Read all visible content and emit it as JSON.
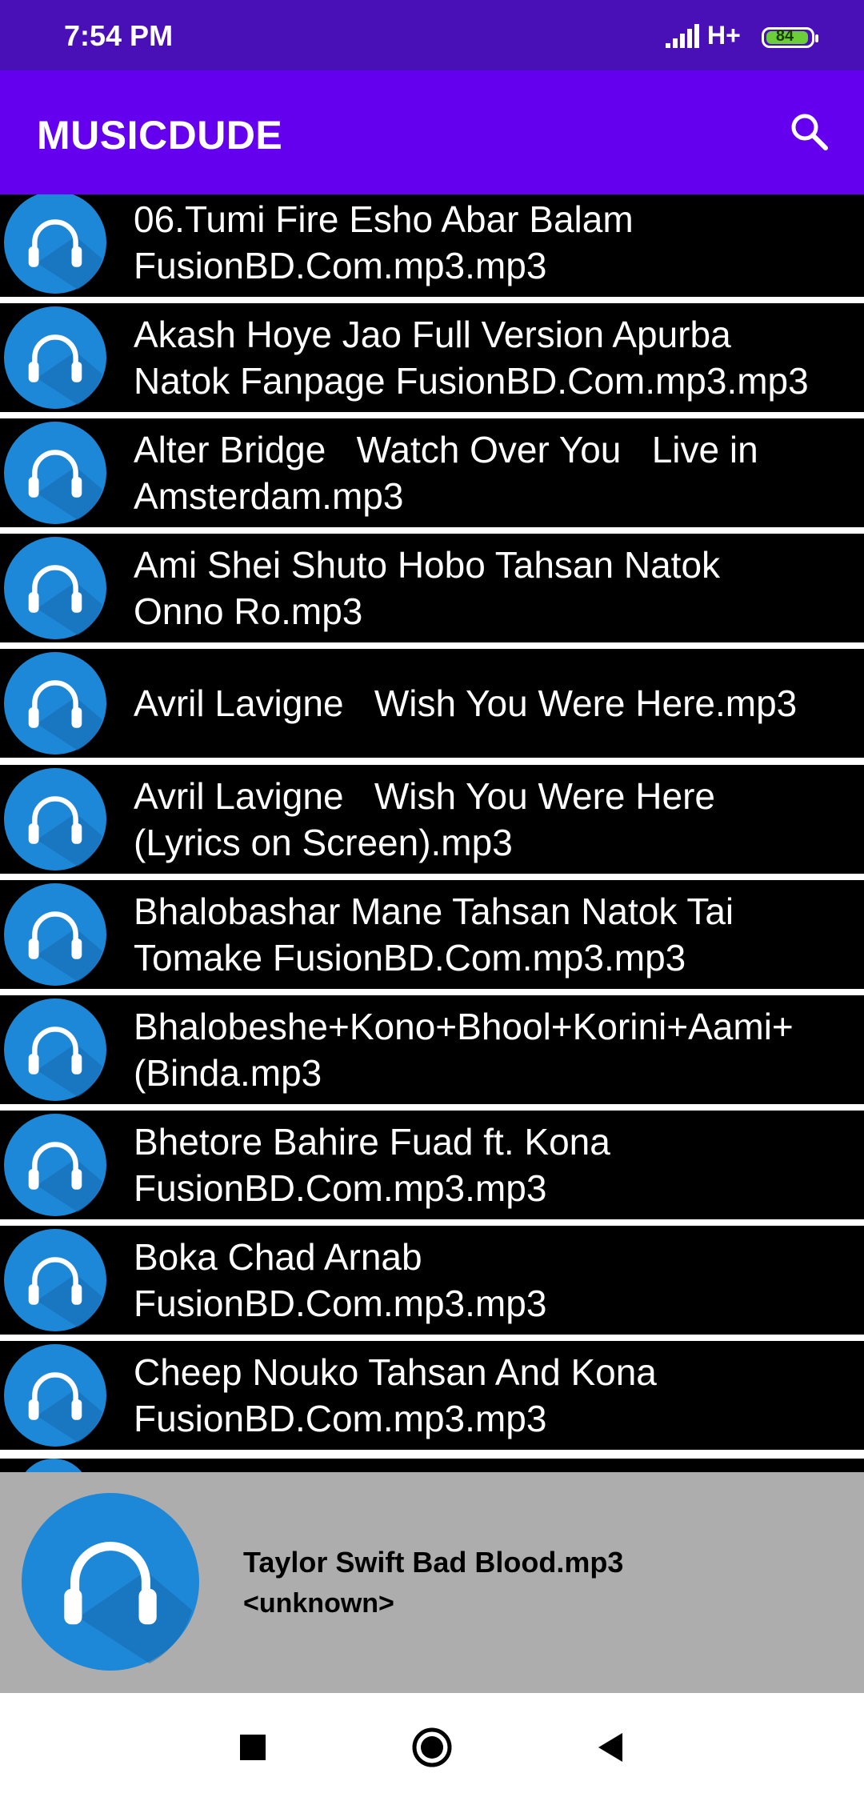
{
  "status_bar": {
    "time": "7:54 PM",
    "network": "H+",
    "battery": "84",
    "signal_icon": "cellular-signal-icon"
  },
  "app_bar": {
    "title": "MUSICDUDE",
    "search_icon": "search-icon"
  },
  "colors": {
    "status_bar": "#4a10b8",
    "app_bar": "#6400ee",
    "avatar": "#1e88d8",
    "row_bg": "#000000",
    "now_playing_bg": "#adadad"
  },
  "songs": [
    {
      "title": "06.Tumi Fire Esho Abar Balam\nFusionBD.Com.mp3.mp3"
    },
    {
      "title": "Akash Hoye Jao Full Version Apurba\nNatok Fanpage FusionBD.Com.mp3.mp3"
    },
    {
      "title": "Alter Bridge   Watch Over You   Live in\nAmsterdam.mp3"
    },
    {
      "title": "Ami Shei Shuto Hobo Tahsan Natok\nOnno Ro.mp3"
    },
    {
      "title": "Avril Lavigne   Wish You Were Here.mp3"
    },
    {
      "title": "Avril Lavigne   Wish You Were Here\n(Lyrics on Screen).mp3"
    },
    {
      "title": "Bhalobashar Mane Tahsan Natok Tai\nTomake FusionBD.Com.mp3.mp3"
    },
    {
      "title": "Bhalobeshe+Kono+Bhool+Korini+Aami+\n(Binda.mp3"
    },
    {
      "title": "Bhetore Bahire Fuad ft. Kona\nFusionBD.Com.mp3.mp3"
    },
    {
      "title": "Boka Chad Arnab\nFusionBD.Com.mp3.mp3"
    },
    {
      "title": "Cheep Nouko Tahsan And Kona\nFusionBD.Com.mp3.mp3"
    }
  ],
  "now_playing": {
    "title": "Taylor Swift Bad Blood.mp3",
    "artist": "<unknown>"
  },
  "nav_bar": {
    "recents_icon": "square-recents-icon",
    "home_icon": "circle-home-icon",
    "back_icon": "triangle-back-icon"
  }
}
